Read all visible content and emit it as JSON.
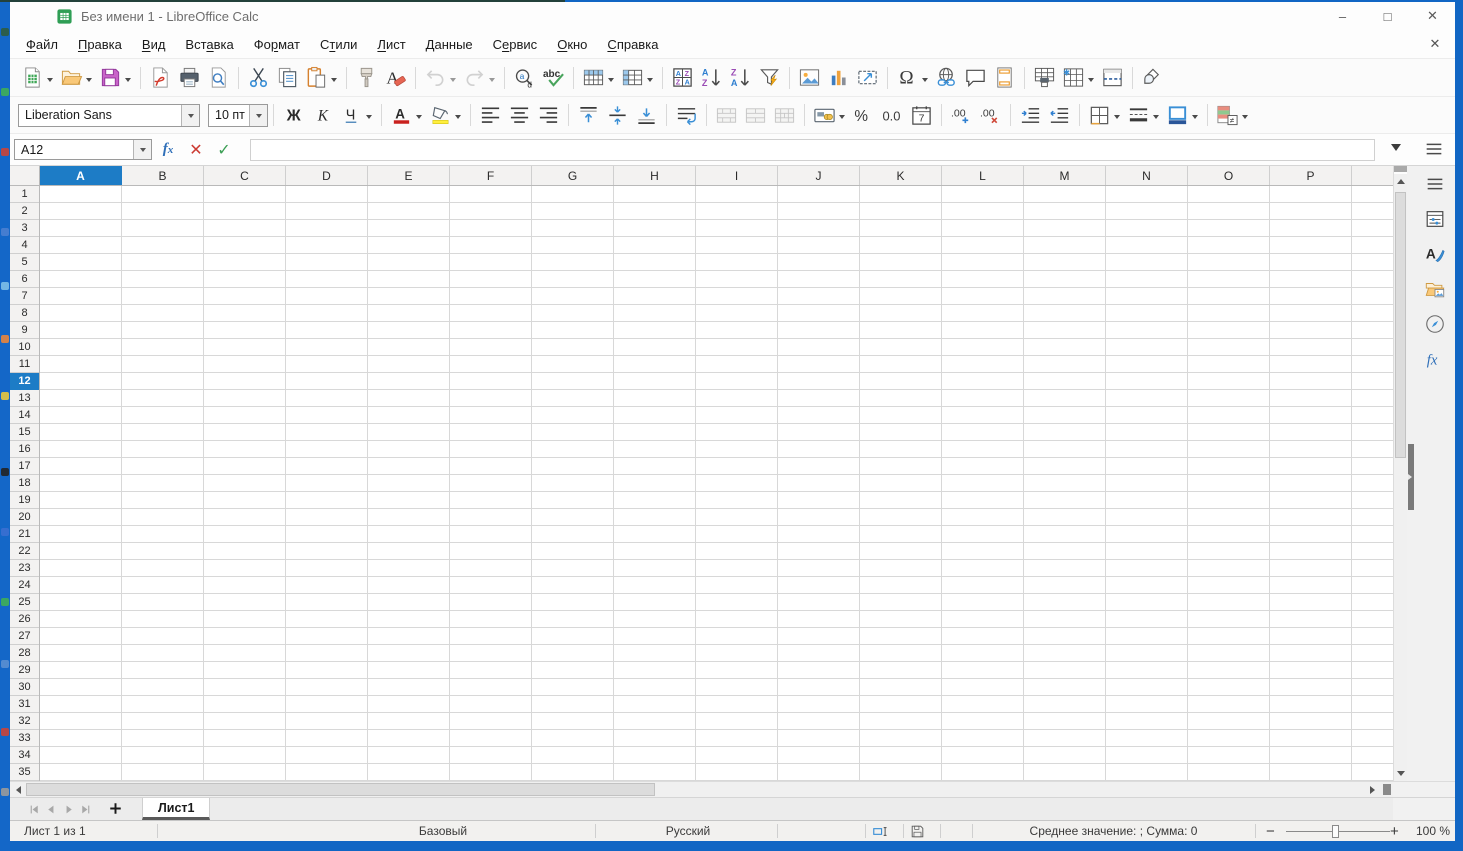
{
  "window": {
    "title": "Без имени 1 - LibreOffice Calc"
  },
  "colors": {
    "accent_blue": "#1d7cc6",
    "desktop_blue": "#1467c8",
    "tab_underline": "#5a5a5a"
  },
  "menu": {
    "items": [
      {
        "label": "Файл",
        "accel": 0
      },
      {
        "label": "Правка",
        "accel": 0
      },
      {
        "label": "Вид",
        "accel": 0
      },
      {
        "label": "Вставка",
        "accel": 3
      },
      {
        "label": "Формат",
        "accel": 2
      },
      {
        "label": "Стили",
        "accel": 1
      },
      {
        "label": "Лист",
        "accel": 0
      },
      {
        "label": "Данные",
        "accel": 0
      },
      {
        "label": "Сервис",
        "accel": 1
      },
      {
        "label": "Окно",
        "accel": 0
      },
      {
        "label": "Справка",
        "accel": 0
      }
    ]
  },
  "toolbar_standard": {
    "groups": [
      [
        {
          "icon": "new-doc",
          "caret": true
        },
        {
          "icon": "open",
          "caret": true
        },
        {
          "icon": "save",
          "caret": true
        }
      ],
      [
        {
          "icon": "export-pdf"
        },
        {
          "icon": "print"
        },
        {
          "icon": "print-preview"
        }
      ],
      [
        {
          "icon": "cut"
        },
        {
          "icon": "copy"
        },
        {
          "icon": "paste",
          "caret": true
        }
      ],
      [
        {
          "icon": "clone-formatting"
        },
        {
          "icon": "clear-formatting"
        }
      ],
      [
        {
          "icon": "undo",
          "caret": true,
          "disabled": true
        },
        {
          "icon": "redo",
          "caret": true,
          "disabled": true
        }
      ],
      [
        {
          "icon": "find-replace"
        },
        {
          "icon": "spelling"
        }
      ],
      [
        {
          "icon": "insert-row",
          "caret": true
        },
        {
          "icon": "insert-column",
          "caret": true
        }
      ],
      [
        {
          "icon": "sort"
        },
        {
          "icon": "sort-ascending"
        },
        {
          "icon": "sort-descending"
        },
        {
          "icon": "autofilter"
        }
      ],
      [
        {
          "icon": "insert-image"
        },
        {
          "icon": "insert-chart"
        },
        {
          "icon": "insert-textbox"
        }
      ],
      [
        {
          "icon": "special-character",
          "caret": true
        },
        {
          "icon": "hyperlink"
        },
        {
          "icon": "comment"
        },
        {
          "icon": "headers-footers"
        }
      ],
      [
        {
          "icon": "print-area"
        },
        {
          "icon": "freeze-panes",
          "caret": true
        },
        {
          "icon": "split-window"
        }
      ],
      [
        {
          "icon": "draw-functions"
        }
      ]
    ]
  },
  "formatting": {
    "font_name": "Liberation Sans",
    "font_size": "10 пт",
    "groups": [
      [
        {
          "icon": "bold"
        },
        {
          "icon": "italic"
        },
        {
          "icon": "underline",
          "caret": true
        }
      ],
      [
        {
          "icon": "font-color",
          "caret": true
        },
        {
          "icon": "highlight-color",
          "caret": true
        }
      ],
      [
        {
          "icon": "align-left"
        },
        {
          "icon": "align-center"
        },
        {
          "icon": "align-right"
        }
      ],
      [
        {
          "icon": "align-top"
        },
        {
          "icon": "center-vertically"
        },
        {
          "icon": "align-bottom"
        }
      ],
      [
        {
          "icon": "wrap-text"
        }
      ],
      [
        {
          "icon": "merge-center",
          "disabled": true
        },
        {
          "icon": "merge-cells",
          "disabled": true
        },
        {
          "icon": "unmerge-cells",
          "disabled": true
        }
      ],
      [
        {
          "icon": "format-currency",
          "caret": true
        },
        {
          "icon": "format-percent"
        },
        {
          "icon": "format-number"
        },
        {
          "icon": "format-date"
        }
      ],
      [
        {
          "icon": "add-decimal"
        },
        {
          "icon": "delete-decimal"
        }
      ],
      [
        {
          "icon": "increase-indent"
        },
        {
          "icon": "decrease-indent"
        }
      ],
      [
        {
          "icon": "borders",
          "caret": true
        },
        {
          "icon": "border-style",
          "caret": true
        },
        {
          "icon": "border-color",
          "caret": true
        }
      ],
      [
        {
          "icon": "conditional-formatting",
          "caret": true
        }
      ]
    ]
  },
  "formula": {
    "cell_reference": "A12",
    "input_value": ""
  },
  "grid": {
    "columns": [
      "A",
      "B",
      "C",
      "D",
      "E",
      "F",
      "G",
      "H",
      "I",
      "J",
      "K",
      "L",
      "M",
      "N",
      "O",
      "P"
    ],
    "rows": [
      1,
      2,
      3,
      4,
      5,
      6,
      7,
      8,
      9,
      10,
      11,
      12,
      13,
      14,
      15,
      16,
      17,
      18,
      19,
      20,
      21,
      22,
      23,
      24,
      25,
      26,
      27,
      28,
      29,
      30,
      31,
      32,
      33,
      34,
      35
    ],
    "selected_column": "A",
    "selected_row": 12
  },
  "sidebar": {
    "icons": [
      "sidebar-menu",
      "properties",
      "styles",
      "gallery",
      "navigator",
      "functions"
    ]
  },
  "sheet_tabs": {
    "nav": [
      "first-sheet",
      "previous-sheet",
      "next-sheet",
      "last-sheet"
    ],
    "tabs": [
      {
        "label": "Лист1",
        "active": true
      }
    ]
  },
  "status": {
    "sheet_info": "Лист 1 из 1",
    "page_style": "Базовый",
    "language": "Русский",
    "stats": "Среднее значение: ; Сумма: 0",
    "zoom_out": "−",
    "zoom_in": "+",
    "zoom_level": "100 %"
  }
}
